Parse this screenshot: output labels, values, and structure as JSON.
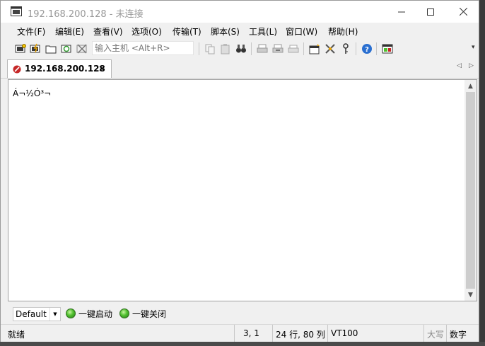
{
  "window": {
    "title": "192.168.200.128 - 未连接",
    "min_icon": "minimize-icon",
    "max_icon": "maximize-icon",
    "close_icon": "close-icon"
  },
  "menu": [
    "文件(F)",
    "编辑(E)",
    "查看(V)",
    "选项(O)",
    "传输(T)",
    "脚本(S)",
    "工具(L)",
    "窗口(W)",
    "帮助(H)"
  ],
  "toolbar": {
    "host_placeholder": "输入主机 <Alt+R>"
  },
  "tab": {
    "label": "192.168.200.128",
    "close": "×"
  },
  "terminal": {
    "text": "Á¬½Ó³¬"
  },
  "button_bar": {
    "session": "Default",
    "start_all": "一键启动",
    "stop_all": "一键关闭"
  },
  "status": {
    "ready": "就绪",
    "cursor": "3,   1",
    "size": "24 行, 80 列",
    "terminal_type": "VT100",
    "caps": "大写",
    "num": "数字"
  },
  "colors": {
    "accent_green": "#4fbf2e",
    "help_blue": "#2a6fd0",
    "tab_icon_red": "#c62828"
  }
}
